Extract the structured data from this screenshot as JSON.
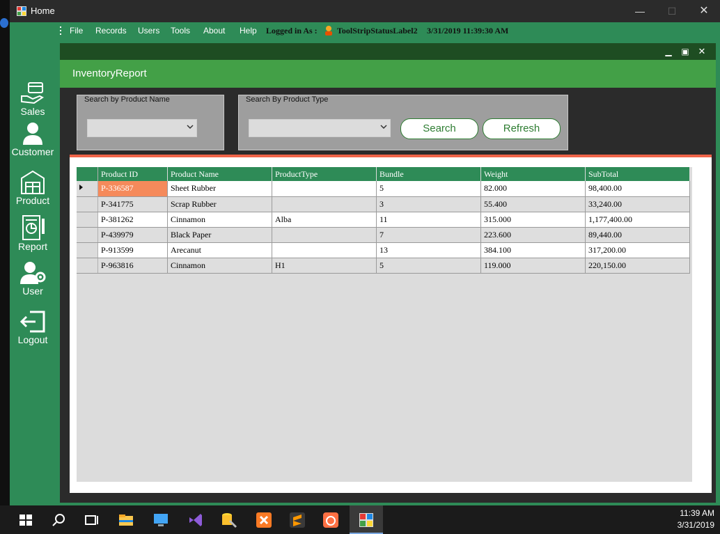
{
  "window": {
    "title": "Home",
    "controls": {
      "minimize": "—",
      "maximize": "☐",
      "close": "✕"
    }
  },
  "menubar": {
    "items": [
      "File",
      "Records",
      "Users",
      "Tools",
      "About",
      "Help"
    ],
    "logged_in_label": "Logged in As :",
    "status_label": "ToolStripStatusLabel2",
    "datetime": "3/31/2019 11:39:30 AM"
  },
  "sidebar": {
    "items": [
      {
        "label": "Sales",
        "icon": "sales-icon"
      },
      {
        "label": "Customer",
        "icon": "customer-icon"
      },
      {
        "label": "Product",
        "icon": "product-icon"
      },
      {
        "label": "Report",
        "icon": "report-icon"
      },
      {
        "label": "User",
        "icon": "user-icon"
      },
      {
        "label": "Logout",
        "icon": "logout-icon"
      }
    ]
  },
  "child": {
    "title": "InventoryReport",
    "search_name": {
      "label": "Search by Product Name",
      "value": ""
    },
    "search_type": {
      "label": "Search By Product Type",
      "value": ""
    },
    "search_button": "Search",
    "refresh_button": "Refresh",
    "table": {
      "columns": [
        "Product ID",
        "Product Name",
        "ProductType",
        "Bundle",
        "Weight",
        "SubTotal"
      ],
      "rows": [
        [
          "P-336587",
          "Sheet Rubber",
          "",
          "5",
          "82.000",
          "98,400.00"
        ],
        [
          "P-341775",
          "Scrap Rubber",
          "",
          "3",
          "55.400",
          "33,240.00"
        ],
        [
          "P-381262",
          "Cinnamon",
          "Alba",
          "11",
          "315.000",
          "1,177,400.00"
        ],
        [
          "P-439979",
          "Black Paper",
          "",
          "7",
          "223.600",
          "89,440.00"
        ],
        [
          "P-913599",
          "Arecanut",
          "",
          "13",
          "384.100",
          "317,200.00"
        ],
        [
          "P-963816",
          "Cinnamon",
          "H1",
          "5",
          "119.000",
          "220,150.00"
        ]
      ]
    }
  },
  "taskbar": {
    "time": "11:39 AM",
    "date": "3/31/2019"
  },
  "colors": {
    "accent_green": "#2e8b57",
    "header_green": "#43a047",
    "selection": "#f58a5b",
    "stripe_red": "#f06449"
  }
}
